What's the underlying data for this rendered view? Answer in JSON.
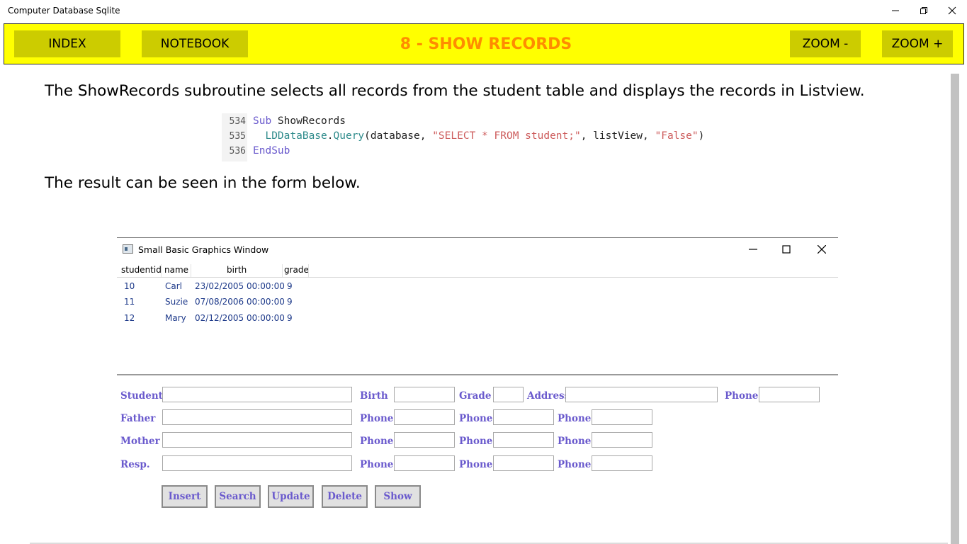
{
  "window": {
    "title": "Computer Database Sqlite"
  },
  "toolbar": {
    "index_label": "INDEX",
    "notebook_label": "NOTEBOOK",
    "page_title": "8 - SHOW RECORDS",
    "zoom_out_label": "ZOOM -",
    "zoom_in_label": "ZOOM +"
  },
  "content": {
    "paragraph1": "The ShowRecords subroutine selects all records from the student table and displays the records in Listview.",
    "paragraph2": "The result can be seen in the form below.",
    "code": {
      "line1": {
        "num": "534",
        "kw": "Sub",
        "name": " ShowRecords"
      },
      "line2": {
        "num": "535",
        "indent": "  ",
        "obj": "LDDataBase",
        "dot": ".",
        "method": "Query",
        "open": "(database, ",
        "str1": "\"SELECT * FROM student;\"",
        "mid": ", listView, ",
        "str2": "\"False\"",
        "close": ")"
      },
      "line3": {
        "num": "536",
        "kw": "EndSub"
      }
    }
  },
  "graphics_window": {
    "title": "Small Basic Graphics Window",
    "columns": [
      "studentid",
      "name",
      "birth",
      "grade"
    ],
    "rows": [
      [
        "10",
        "Carl",
        "23/02/2005 00:00:00",
        "9"
      ],
      [
        "11",
        "Suzie",
        "07/08/2006 00:00:00",
        "9"
      ],
      [
        "12",
        "Mary",
        "02/12/2005 00:00:00",
        "9"
      ]
    ],
    "form": {
      "student": "Student",
      "birth": "Birth",
      "grade": "Grade",
      "address": "Address",
      "phone": "Phone",
      "father": "Father",
      "mother": "Mother",
      "resp": "Resp."
    },
    "buttons": {
      "insert": "Insert",
      "search": "Search",
      "update": "Update",
      "delete": "Delete",
      "show": "Show"
    }
  }
}
